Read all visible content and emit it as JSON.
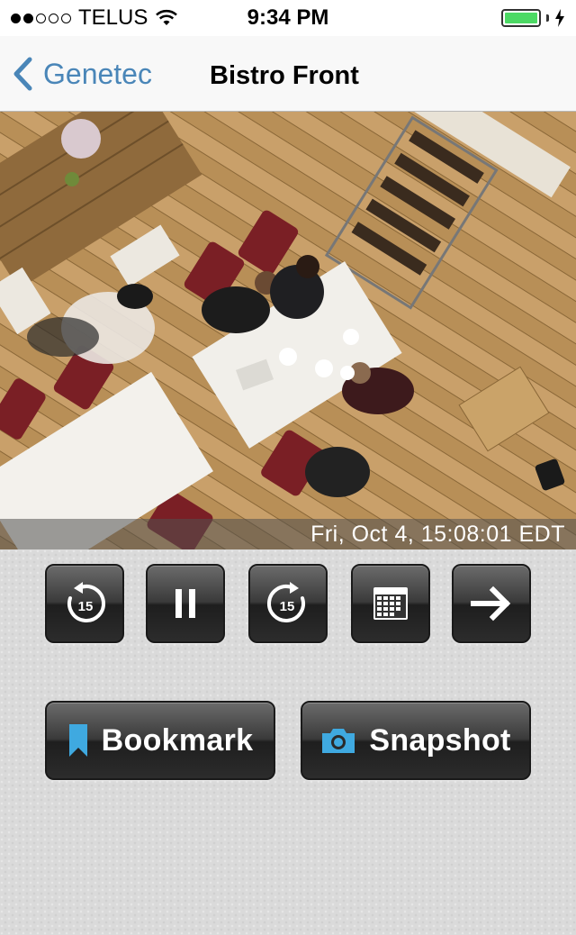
{
  "status_bar": {
    "carrier": "TELUS",
    "time": "9:34 PM",
    "signal_bars_filled": 2,
    "signal_bars_total": 5,
    "battery_level": 1.0,
    "battery_color": "#4cd964"
  },
  "nav": {
    "back_label": "Genetec",
    "title": "Bistro Front",
    "accent": "#4a86b8"
  },
  "video": {
    "timestamp": "Fri, Oct 4, 15:08:01 EDT"
  },
  "controls": {
    "rewind_seconds": "15",
    "forward_seconds": "15",
    "icons": [
      "rewind-15-icon",
      "pause-icon",
      "forward-15-icon",
      "calendar-icon",
      "arrow-right-icon"
    ]
  },
  "actions": {
    "bookmark_label": "Bookmark",
    "snapshot_label": "Snapshot",
    "icon_color": "#3fa9e0"
  }
}
